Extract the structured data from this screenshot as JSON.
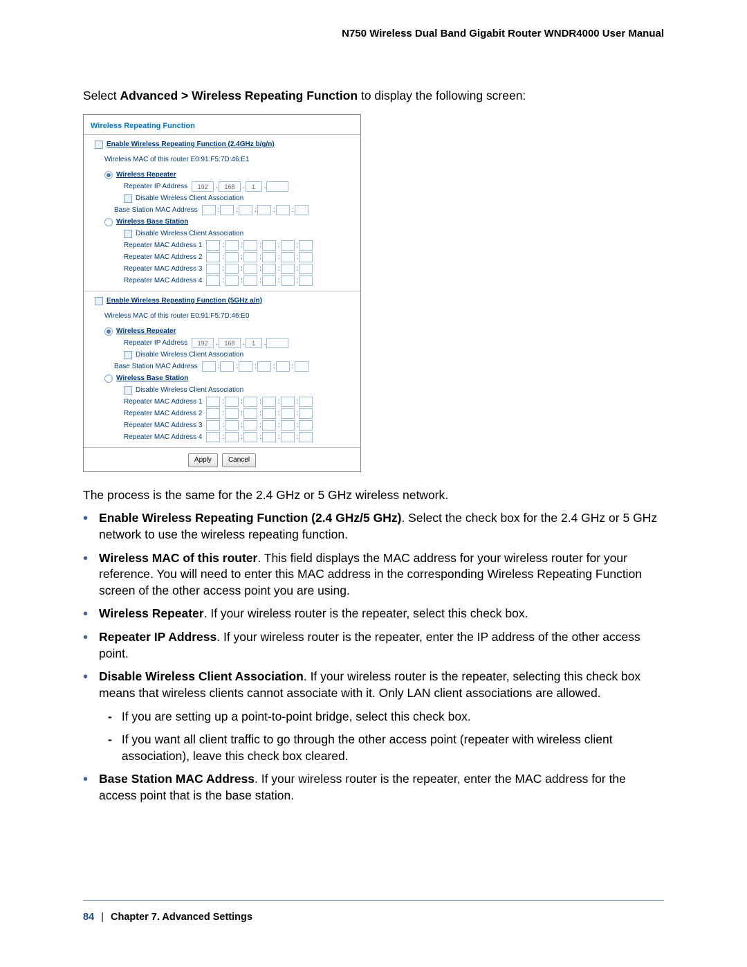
{
  "header": "N750 Wireless Dual Band Gigabit Router WNDR4000 User Manual",
  "intro_1": "Select ",
  "intro_bold": "Advanced > Wireless Repeating Function",
  "intro_2": " to display the following screen:",
  "figure": {
    "title": "Wireless Repeating Function",
    "section24_enable": "Enable Wireless Repeating Function (2.4GHz b/g/n)",
    "section24_mac_label": "Wireless MAC of this router E0:91:F5:7D:46:E1",
    "repeater_label": "Wireless Repeater",
    "repeater_ip_label": "Repeater IP Address",
    "ip_192": "192",
    "ip_168": "168",
    "ip_1": "1",
    "disable_assoc": "Disable Wireless Client Association",
    "base_mac_label": "Base Station MAC Address",
    "base_station_label": "Wireless Base Station",
    "rep_mac1": "Repeater MAC Address 1",
    "rep_mac2": "Repeater MAC Address 2",
    "rep_mac3": "Repeater MAC Address 3",
    "rep_mac4": "Repeater MAC Address 4",
    "section5_enable": "Enable Wireless Repeating Function (5GHz a/n)",
    "section5_mac_label": "Wireless MAC of this router E0:91:F5:7D:46:E0",
    "apply": "Apply",
    "cancel": "Cancel"
  },
  "after_fig": "The process is the same for the 2.4 GHz or 5 GHz wireless network.",
  "bullets": [
    {
      "bold": "Enable Wireless Repeating Function (2.4 GHz/5 GHz)",
      "rest": ". Select the check box for the 2.4 GHz or 5 GHz network to use the wireless repeating function."
    },
    {
      "bold": "Wireless MAC of this router",
      "rest": ". This field displays the MAC address for your wireless router for your reference. You will need to enter this MAC address in the corresponding Wireless Repeating Function screen of the other access point you are using."
    },
    {
      "bold": "Wireless Repeater",
      "rest": ". If your wireless router is the repeater, select this check box."
    },
    {
      "bold": "Repeater IP Address",
      "rest": ". If your wireless router is the repeater, enter the IP address of the other access point."
    },
    {
      "bold": "Disable Wireless Client Association",
      "rest": ". If your wireless router is the repeater, selecting this check box means that wireless clients cannot associate with it. Only LAN client associations are allowed."
    },
    {
      "bold": "Base Station MAC Address",
      "rest": ". If your wireless router is the repeater, enter the MAC address for the access point that is the base station."
    }
  ],
  "sub": [
    "If you are setting up a point-to-point bridge, select this check box.",
    "If you want all client traffic to go through the other access point (repeater with wireless client association), leave this check box cleared."
  ],
  "footer": {
    "page": "84",
    "sep": "|",
    "chapter": "Chapter 7.  Advanced Settings"
  }
}
